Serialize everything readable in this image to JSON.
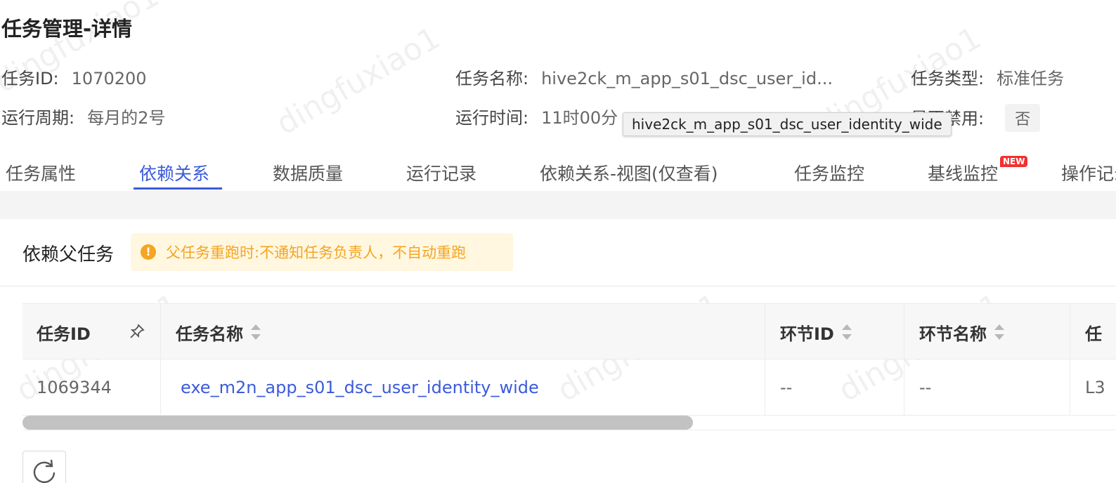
{
  "page_title": "任务管理-详情",
  "info": {
    "task_id_label": "任务ID:",
    "task_id_value": "1070200",
    "task_name_label": "任务名称:",
    "task_name_value": "hive2ck_m_app_s01_dsc_user_id...",
    "task_type_label": "任务类型:",
    "task_type_value": "标准任务",
    "run_cycle_label": "运行周期:",
    "run_cycle_value": "每月的2号",
    "run_time_label": "运行时间:",
    "run_time_value": "11时00分",
    "disabled_label": "是否禁用:",
    "disabled_value": "否"
  },
  "tooltip_text": "hive2ck_m_app_s01_dsc_user_identity_wide",
  "tabs": [
    {
      "label": "任务属性"
    },
    {
      "label": "依赖关系"
    },
    {
      "label": "数据质量"
    },
    {
      "label": "运行记录"
    },
    {
      "label": "依赖关系-视图(仅查看)"
    },
    {
      "label": "任务监控"
    },
    {
      "label": "基线监控"
    },
    {
      "label": "操作记录"
    }
  ],
  "active_tab": "依赖关系",
  "new_badge": "NEW",
  "section": {
    "title": "依赖父任务",
    "warning": "父任务重跑时:不通知任务负责人，不自动重跑",
    "warning_icon": "!"
  },
  "table": {
    "headers": [
      "任务ID",
      "任务名称",
      "环节ID",
      "环节名称",
      "任"
    ],
    "rows": [
      {
        "task_id": "1069344",
        "task_name": "exe_m2n_app_s01_dsc_user_identity_wide",
        "stage_id": "--",
        "stage_name": "--",
        "extra": "L3"
      }
    ]
  },
  "watermark": "dingfuxiao1",
  "colors": {
    "accent": "#3b5bdb",
    "warning": "#f4a522",
    "warning_bg": "#fff7e0",
    "new_badge": "#f23030"
  }
}
